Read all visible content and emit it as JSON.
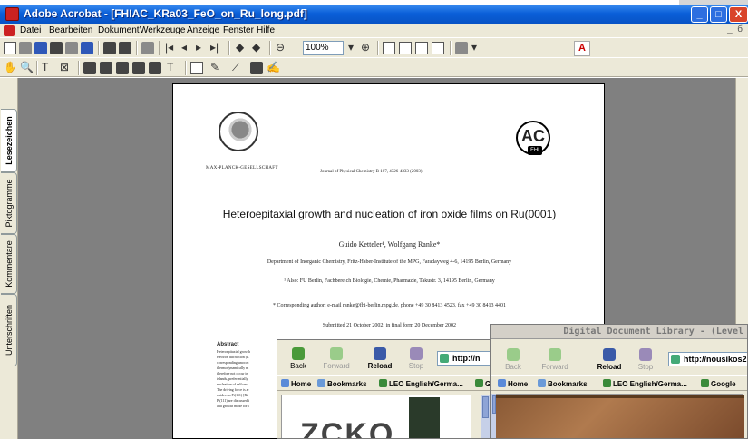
{
  "window": {
    "title": "Adobe Acrobat - [FHIAC_KRa03_FeO_on_Ru_long.pdf]",
    "minimize_label": "_",
    "maximize_label": "□",
    "close_label": "X"
  },
  "menu": {
    "items": [
      "Datei",
      "Bearbeiten",
      "Dokument",
      "Werkzeuge",
      "Anzeige",
      "Fenster",
      "Hilfe"
    ],
    "doc_controls": "_  б"
  },
  "toolbar": {
    "zoom_value": "100%"
  },
  "side_tabs": [
    "Lesezeichen",
    "Piktogramme",
    "Kommentare",
    "Unterschriften"
  ],
  "pdf": {
    "mpg_caption": "MAX-PLANCK-GESELLSCHAFT",
    "ac_logo": "AC",
    "fhi_logo": "FHI",
    "journal": "Journal of Physical Chemistry B 107, 4326-4333 (2003)",
    "title": "Heteroepitaxial growth and nucleation of iron oxide films on Ru(0001)",
    "authors": "Guido Ketteler¹, Wolfgang Ranke*",
    "affiliation": "Department of Inorganic Chemistry, Fritz-Haber-Institute of the MPG, Faradayweg 4-6, 14195 Berlin, Germany",
    "affiliation_alt": "¹ Also: FU Berlin, Fachbereich Biologie, Chemie, Pharmazie, Takustr. 3, 14195 Berlin, Germany",
    "corresponding": "* Corresponding author: e-mail ranke@fhi-berlin.mpg.de, phone +49 30 8413 4523, fax +49 30 8413 4401",
    "submitted": "Submitted 21 October 2002; in final form 20 December 2002",
    "abstract_heading": "Abstract",
    "abstract_lines": [
      "Heteroepitaxial growth",
      "electron diffraction (L",
      "corresponding unoccu",
      "thermodynamically m",
      "therefore not occur in",
      "islands, preferentially",
      "nucleation of self-ass",
      "The driving force is ar",
      "oxides on Pt(111) [Ri",
      "Pt(111) are discussed i",
      "and growth mode for t"
    ]
  },
  "browser_left": {
    "back": "Back",
    "forward": "Forward",
    "reload": "Reload",
    "stop": "Stop",
    "url": "http://n",
    "bookmarks": [
      "Home",
      "Bookmarks",
      "LEO English/Germa...",
      "Goo"
    ]
  },
  "browser_right": {
    "window_title": "Digital Document Library - (Level",
    "back": "Back",
    "forward": "Forward",
    "reload": "Reload",
    "stop": "Stop",
    "url": "http://nousikos2",
    "bookmarks": [
      "Home",
      "Bookmarks",
      "LEO English/Germa...",
      "Google"
    ]
  },
  "colors": {
    "titlebar": "#0a5fd8",
    "chrome": "#ece9d8",
    "workspace": "#808080"
  }
}
